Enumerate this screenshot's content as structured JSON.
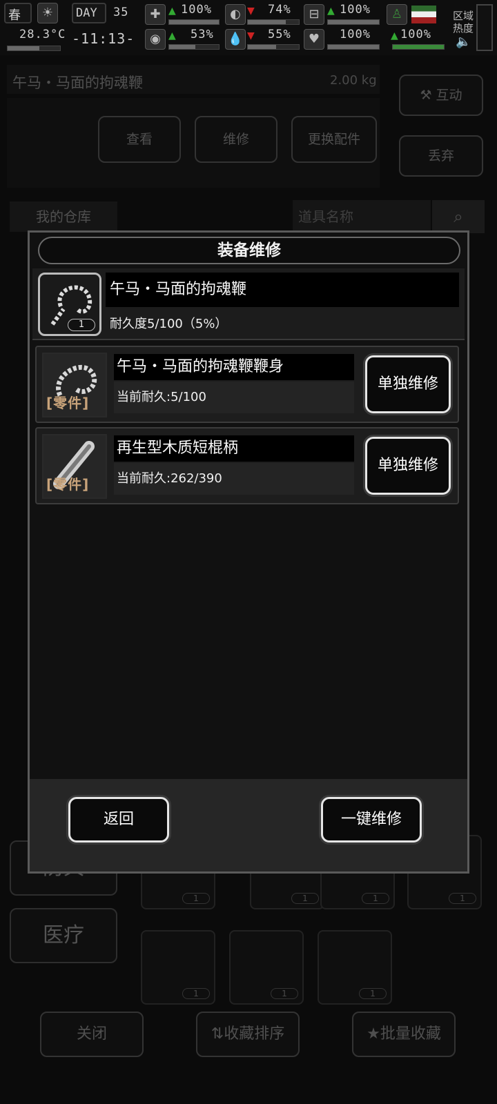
{
  "status_bar": {
    "season": "春",
    "temperature": "28.3°C",
    "day_label": "DAY",
    "day_number": "35",
    "time": "-11:13-",
    "stat_1": "100%",
    "stat_2": "74%",
    "stat_3": "100%",
    "stat_4": "53%",
    "stat_5": "55%",
    "stat_6": "100%",
    "stat_7": "100%",
    "region_label_1": "区域",
    "region_label_2": "热度"
  },
  "background": {
    "item_title": "午马・马面的拘魂鞭",
    "weight": "2.00 kg",
    "btn_view": "查看",
    "btn_repair": "维修",
    "btn_replace": "更换配件",
    "btn_interact": "互动",
    "btn_discard": "丢弃",
    "warehouse_label": "我的仓库",
    "search_placeholder": "道具名称",
    "cat_armor": "防具",
    "cat_medical": "医疗",
    "btn_close": "关闭",
    "btn_sort": "收藏排序",
    "btn_batch": "批量收藏"
  },
  "dialog": {
    "title": "装备维修",
    "item": {
      "name": "午马・马面的拘魂鞭",
      "count": "1",
      "durability": "耐久度5/100（5%）"
    },
    "parts": [
      {
        "tag": "零件",
        "name": "午马・马面的拘魂鞭鞭身",
        "durability": "当前耐久:5/100",
        "button": "单独维修"
      },
      {
        "tag": "零件",
        "name": "再生型木质短棍柄",
        "durability": "当前耐久:262/390",
        "button": "单独维修"
      }
    ],
    "back_button": "返回",
    "repair_all_button": "一键维修"
  }
}
